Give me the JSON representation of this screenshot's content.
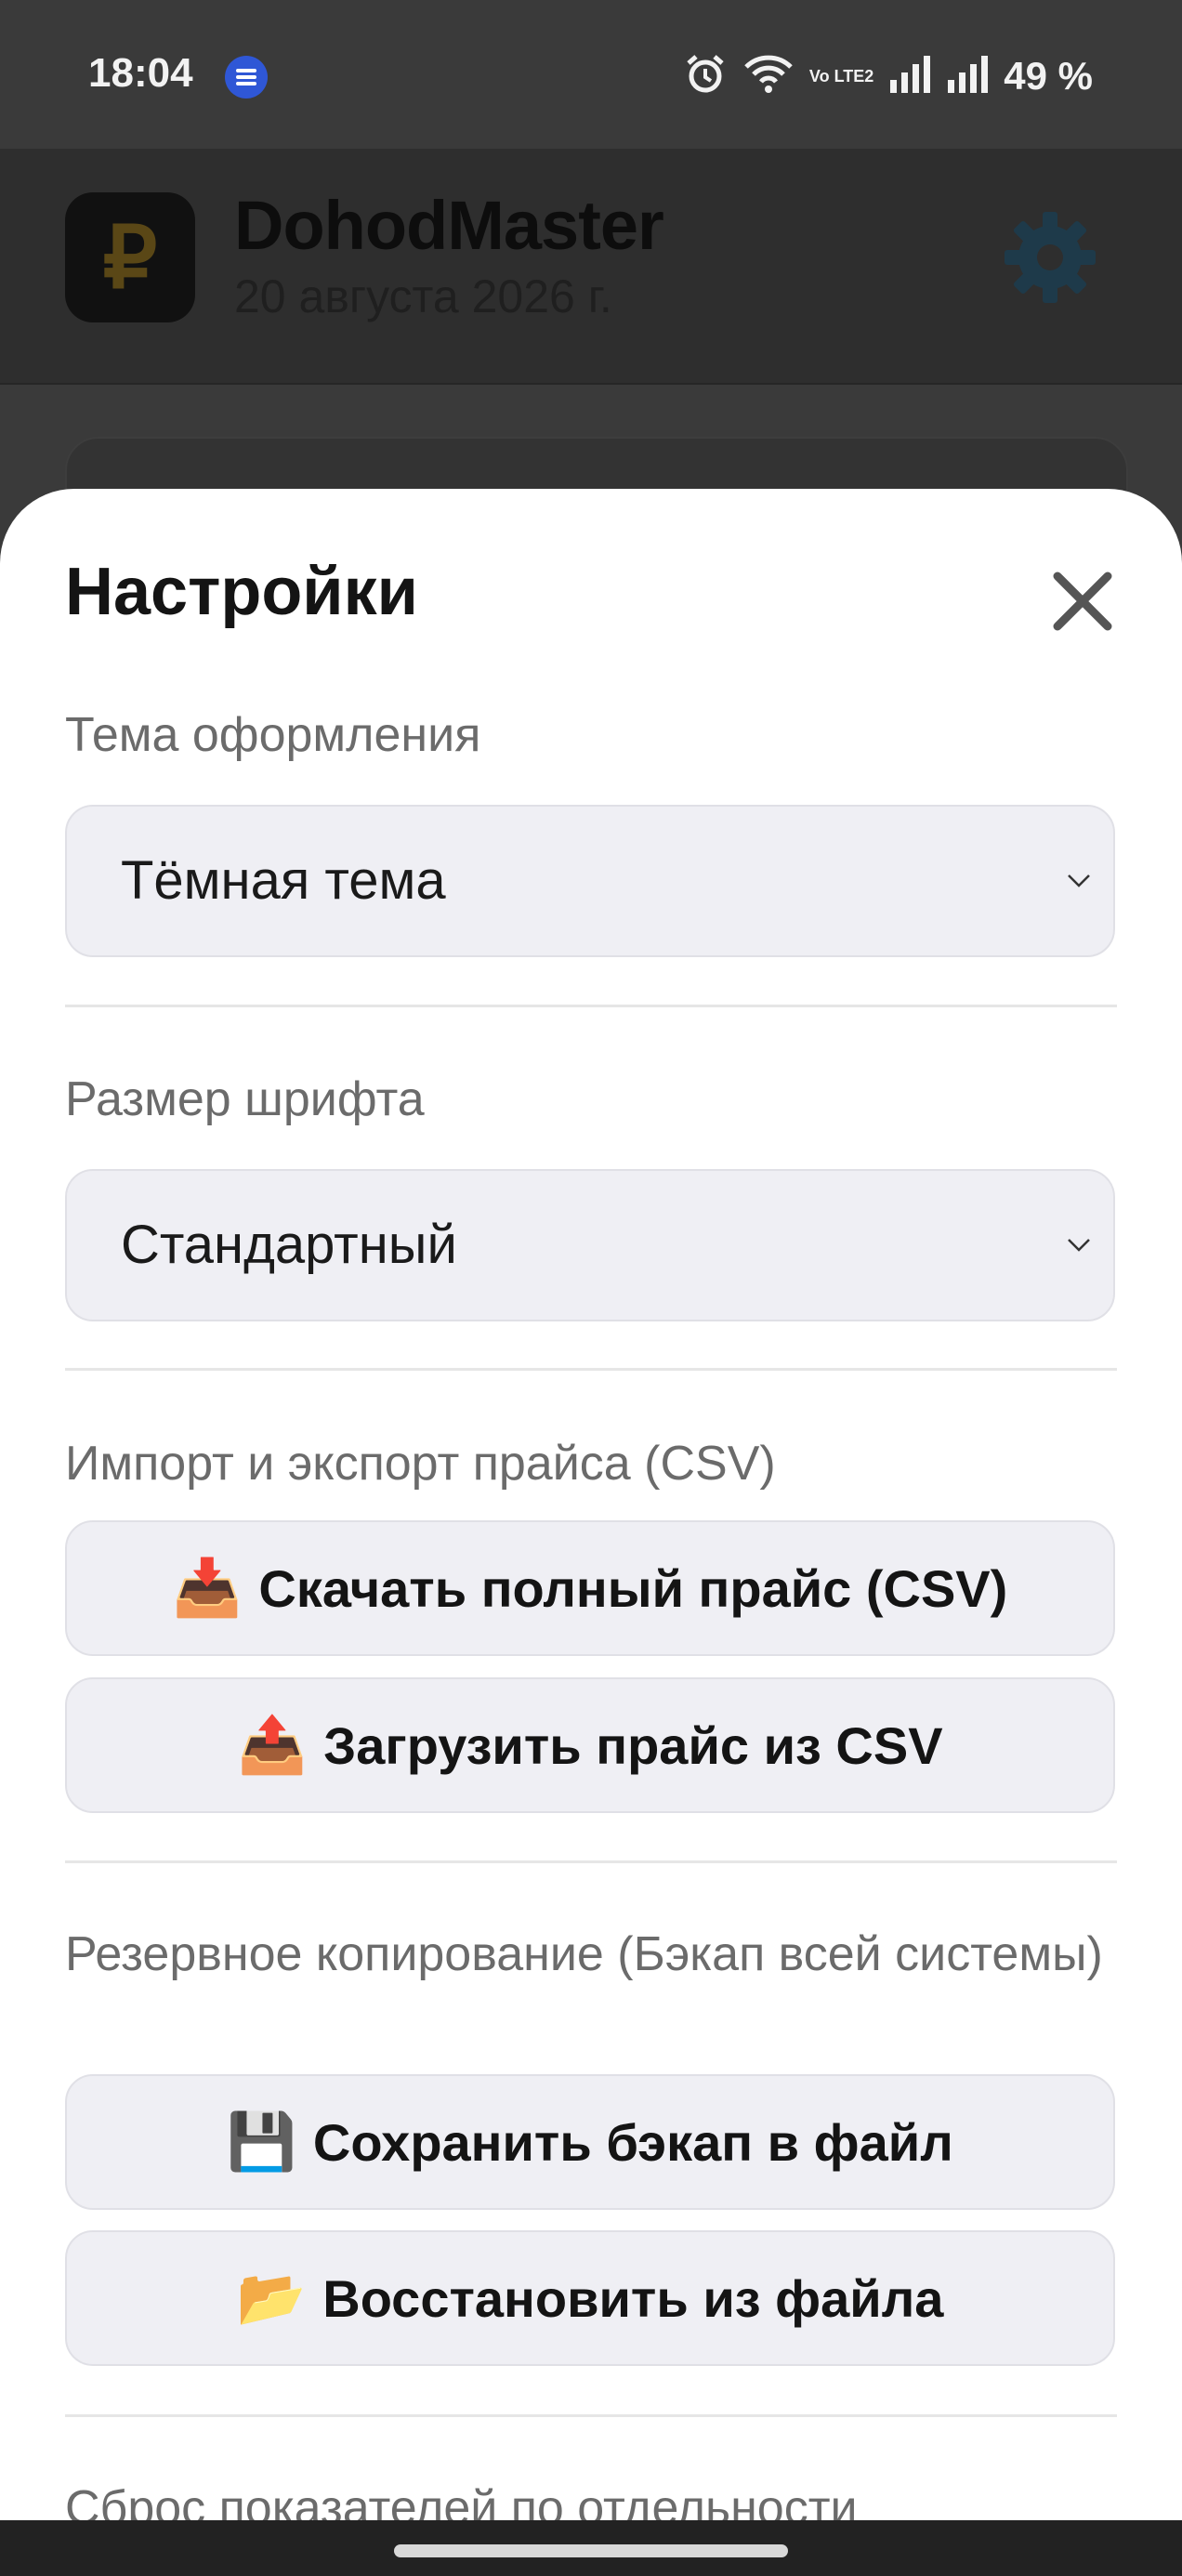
{
  "status_bar": {
    "time": "18:04",
    "app_icon": "messenger-icon",
    "volte": "Vo LTE2",
    "battery": "49 %",
    "icons": [
      "alarm-icon",
      "wifi-icon",
      "volte-icon",
      "signal-icon",
      "signal-icon"
    ]
  },
  "header": {
    "logo_symbol": "₽",
    "app_name": "DohodMaster",
    "date": "20 августа 2026 г.",
    "settings_icon": "gear-icon"
  },
  "settings": {
    "title": "Настройки",
    "close_icon": "close-icon",
    "theme": {
      "label": "Тема оформления",
      "value": "Тёмная тема"
    },
    "font_size": {
      "label": "Размер шрифта",
      "value": "Стандартный"
    },
    "price_csv": {
      "label": "Импорт и экспорт прайса (CSV)",
      "download_icon": "📥",
      "download_label": "Скачать полный прайс (CSV)",
      "upload_icon": "📤",
      "upload_label": "Загрузить прайс из CSV"
    },
    "backup": {
      "label": "Резервное копирование (Бэкап всей системы)",
      "save_icon": "💾",
      "save_label": "Сохранить бэкап в файл",
      "restore_icon": "📂",
      "restore_label": "Восстановить из файла"
    },
    "reset": {
      "label": "Сброс показателей по отдельности"
    }
  },
  "colors": {
    "overlay": "#3a3a3a",
    "sheet_bg": "#ffffff",
    "control_bg": "#efeff4",
    "label_gray": "#6b6b6b",
    "logo_gold": "#5a4716"
  }
}
